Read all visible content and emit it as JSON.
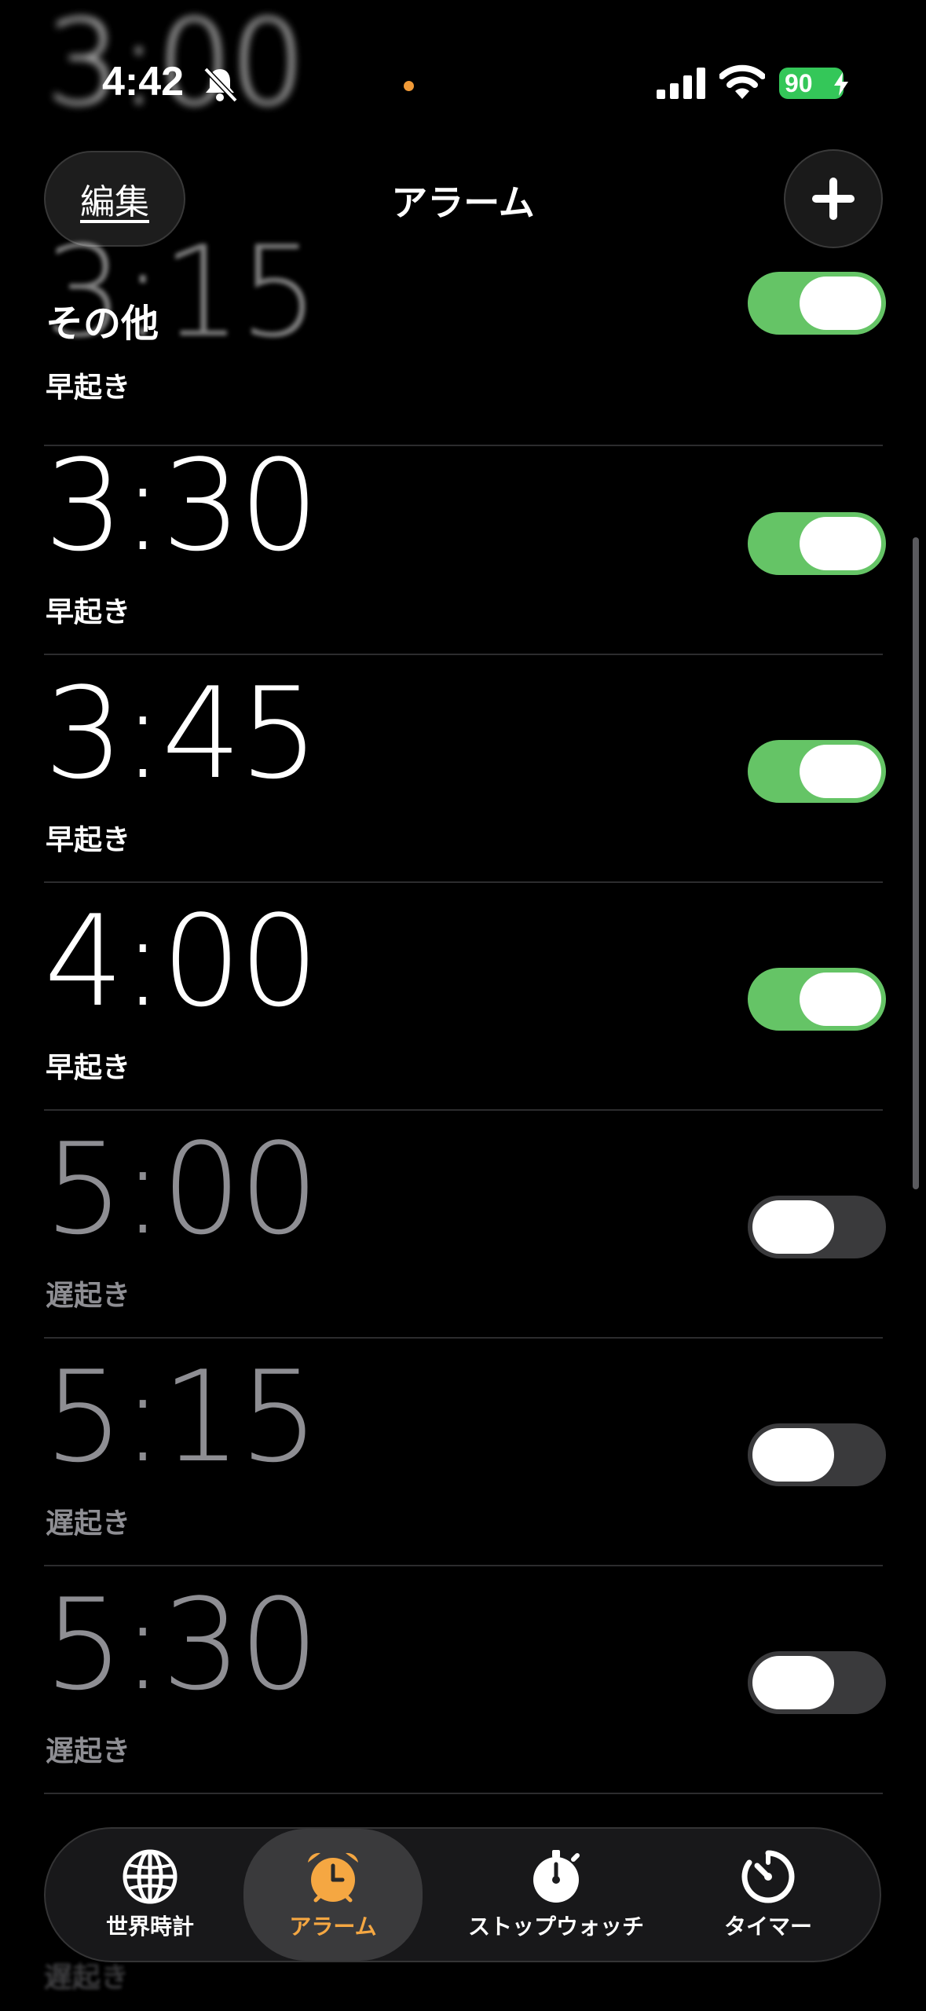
{
  "status_bar": {
    "time": "4:42",
    "battery": "90",
    "accent_dot": "#f19a37"
  },
  "header": {
    "edit_label": "編集",
    "title": "アラーム",
    "add_icon": "plus-icon"
  },
  "section": {
    "title": "その他"
  },
  "ghost": {
    "top_time": "3:00",
    "first_row_time": "3:15"
  },
  "alarms": [
    {
      "time": "3:15",
      "label": "早起き",
      "enabled": true
    },
    {
      "time": "3:30",
      "label": "早起き",
      "enabled": true
    },
    {
      "time": "3:45",
      "label": "早起き",
      "enabled": true
    },
    {
      "time": "4:00",
      "label": "早起き",
      "enabled": true
    },
    {
      "time": "5:00",
      "label": "遅起き",
      "enabled": false
    },
    {
      "time": "5:15",
      "label": "遅起き",
      "enabled": false
    },
    {
      "time": "5:30",
      "label": "遅起き",
      "enabled": false
    }
  ],
  "bottom_peek_label": "遅起き",
  "tabs": [
    {
      "label": "世界時計",
      "icon": "globe-icon",
      "active": false
    },
    {
      "label": "アラーム",
      "icon": "alarm-clock-icon",
      "active": true
    },
    {
      "label": "ストップウォッチ",
      "icon": "stopwatch-icon",
      "active": false
    },
    {
      "label": "タイマー",
      "icon": "timer-icon",
      "active": false
    }
  ],
  "colors": {
    "toggle_on": "#65c466",
    "toggle_off": "#3a3a3c",
    "tab_active": "#f5a742"
  }
}
